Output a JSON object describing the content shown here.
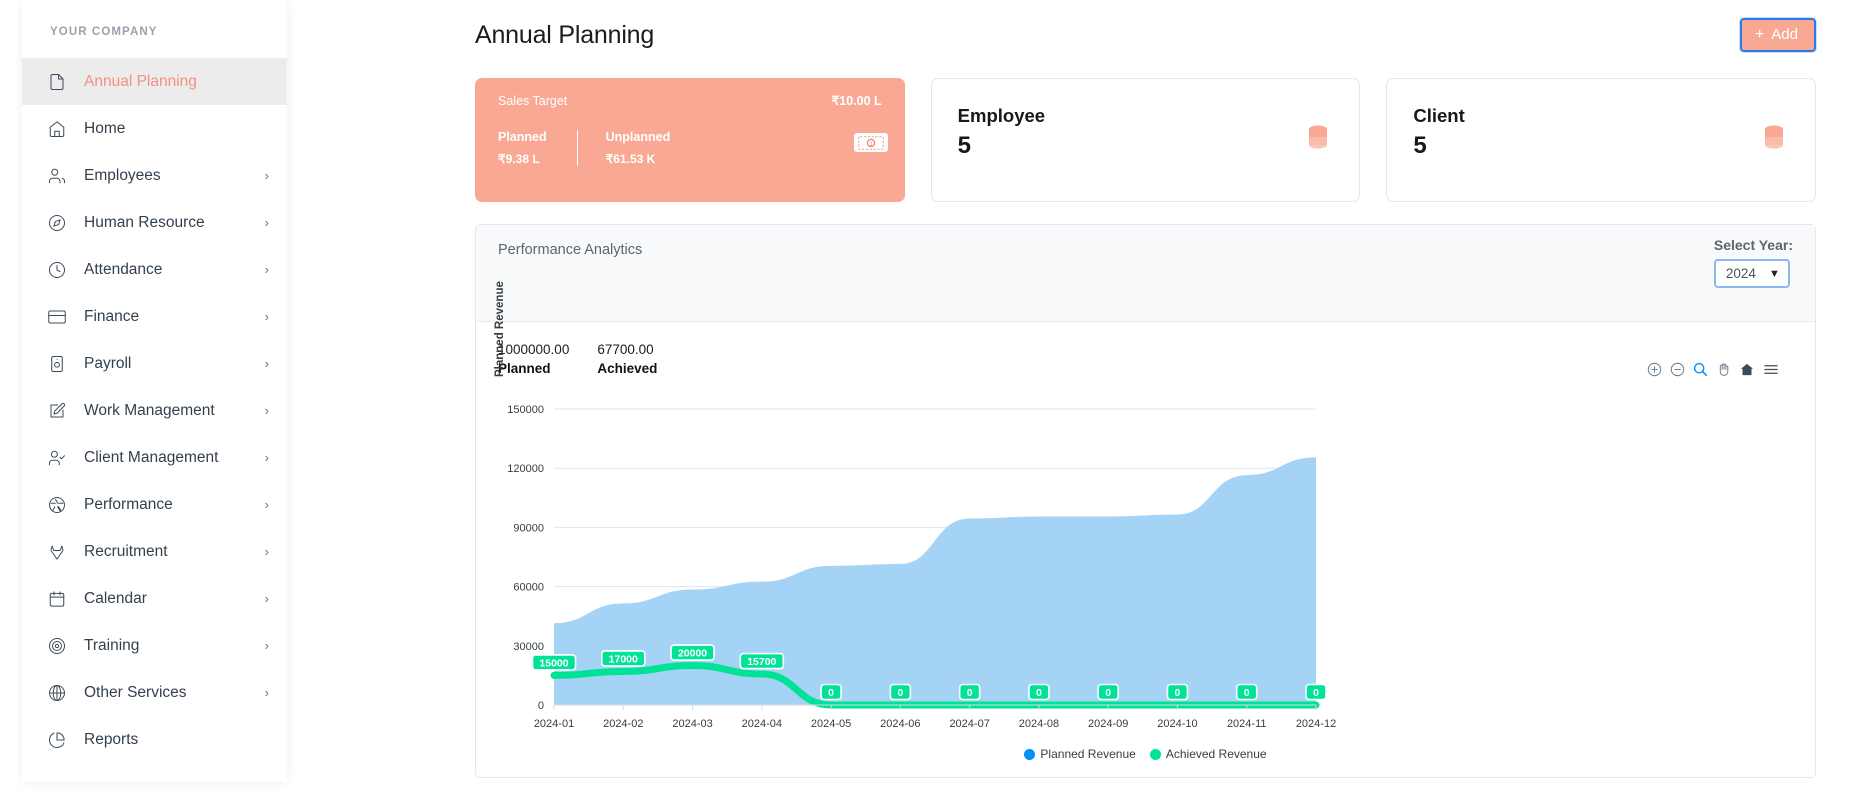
{
  "sidebar": {
    "brand": "YOUR COMPANY",
    "items": [
      {
        "label": "Annual Planning",
        "icon": "file-icon",
        "chevron": false,
        "active": true
      },
      {
        "label": "Home",
        "icon": "home-icon",
        "chevron": false,
        "active": false
      },
      {
        "label": "Employees",
        "icon": "users-icon",
        "chevron": true,
        "active": false
      },
      {
        "label": "Human Resource",
        "icon": "compass-icon",
        "chevron": true,
        "active": false
      },
      {
        "label": "Attendance",
        "icon": "clock-icon",
        "chevron": true,
        "active": false
      },
      {
        "label": "Finance",
        "icon": "credit-card-icon",
        "chevron": true,
        "active": false
      },
      {
        "label": "Payroll",
        "icon": "payroll-icon",
        "chevron": true,
        "active": false
      },
      {
        "label": "Work Management",
        "icon": "edit-square-icon",
        "chevron": true,
        "active": false
      },
      {
        "label": "Client Management",
        "icon": "user-check-icon",
        "chevron": true,
        "active": false
      },
      {
        "label": "Performance",
        "icon": "aperture-icon",
        "chevron": true,
        "active": false
      },
      {
        "label": "Recruitment",
        "icon": "gitlab-icon",
        "chevron": true,
        "active": false
      },
      {
        "label": "Calendar",
        "icon": "calendar-icon",
        "chevron": true,
        "active": false
      },
      {
        "label": "Training",
        "icon": "target-icon",
        "chevron": true,
        "active": false
      },
      {
        "label": "Other Services",
        "icon": "globe-icon",
        "chevron": true,
        "active": false
      },
      {
        "label": "Reports",
        "icon": "pie-chart-icon",
        "chevron": false,
        "active": false
      }
    ]
  },
  "header": {
    "title": "Annual Planning",
    "add_button": "Add",
    "add_plus": "+"
  },
  "cards": {
    "sales_target": {
      "label": "Sales Target",
      "amount": "₹10.00 L",
      "planned_label": "Planned",
      "planned_value": "₹9.38 L",
      "unplanned_label": "Unplanned",
      "unplanned_value": "₹61.53 K",
      "bg_color": "#f9a894"
    },
    "employee": {
      "title": "Employee",
      "value": "5",
      "icon": "database-icon"
    },
    "client": {
      "title": "Client",
      "value": "5",
      "icon": "database-icon"
    }
  },
  "analytics": {
    "panel_title": "Performance Analytics",
    "year_label": "Select Year:",
    "year_value": "2024",
    "year_options": [
      "2024"
    ],
    "kpis": [
      {
        "number": "1000000.00",
        "name": "Planned"
      },
      {
        "number": "67700.00",
        "name": "Achieved"
      }
    ],
    "toolbar_icons": [
      "zoom-in-icon",
      "zoom-out-icon",
      "selection-zoom-icon",
      "pan-icon",
      "reset-home-icon",
      "menu-icon"
    ]
  },
  "chart_data": {
    "type": "area",
    "title": "",
    "xlabel": "",
    "ylabel": "Planned Revenue",
    "ylim": [
      0,
      150000
    ],
    "yticks": [
      0,
      30000,
      60000,
      90000,
      120000,
      150000
    ],
    "grid": true,
    "legend_position": "bottom",
    "categories": [
      "2024-01",
      "2024-02",
      "2024-03",
      "2024-04",
      "2024-05",
      "2024-06",
      "2024-07",
      "2024-08",
      "2024-09",
      "2024-10",
      "2024-11",
      "2024-12"
    ],
    "series": [
      {
        "name": "Planned Revenue",
        "color": "#a5d3f5",
        "line_color": "#a5d3f5",
        "values": [
          41000,
          51000,
          58000,
          62000,
          70000,
          71000,
          94000,
          95000,
          95000,
          96000,
          116000,
          125000
        ],
        "data_labels": false
      },
      {
        "name": "Achieved Revenue",
        "color": "#00e396",
        "line_color": "#00e396",
        "values": [
          15000,
          17000,
          20000,
          15700,
          0,
          0,
          0,
          0,
          0,
          0,
          0,
          0
        ],
        "data_labels": true,
        "labels": [
          "15000",
          "17000",
          "20000",
          "15700",
          "0",
          "0",
          "0",
          "0",
          "0",
          "0",
          "0",
          "0"
        ]
      }
    ]
  }
}
